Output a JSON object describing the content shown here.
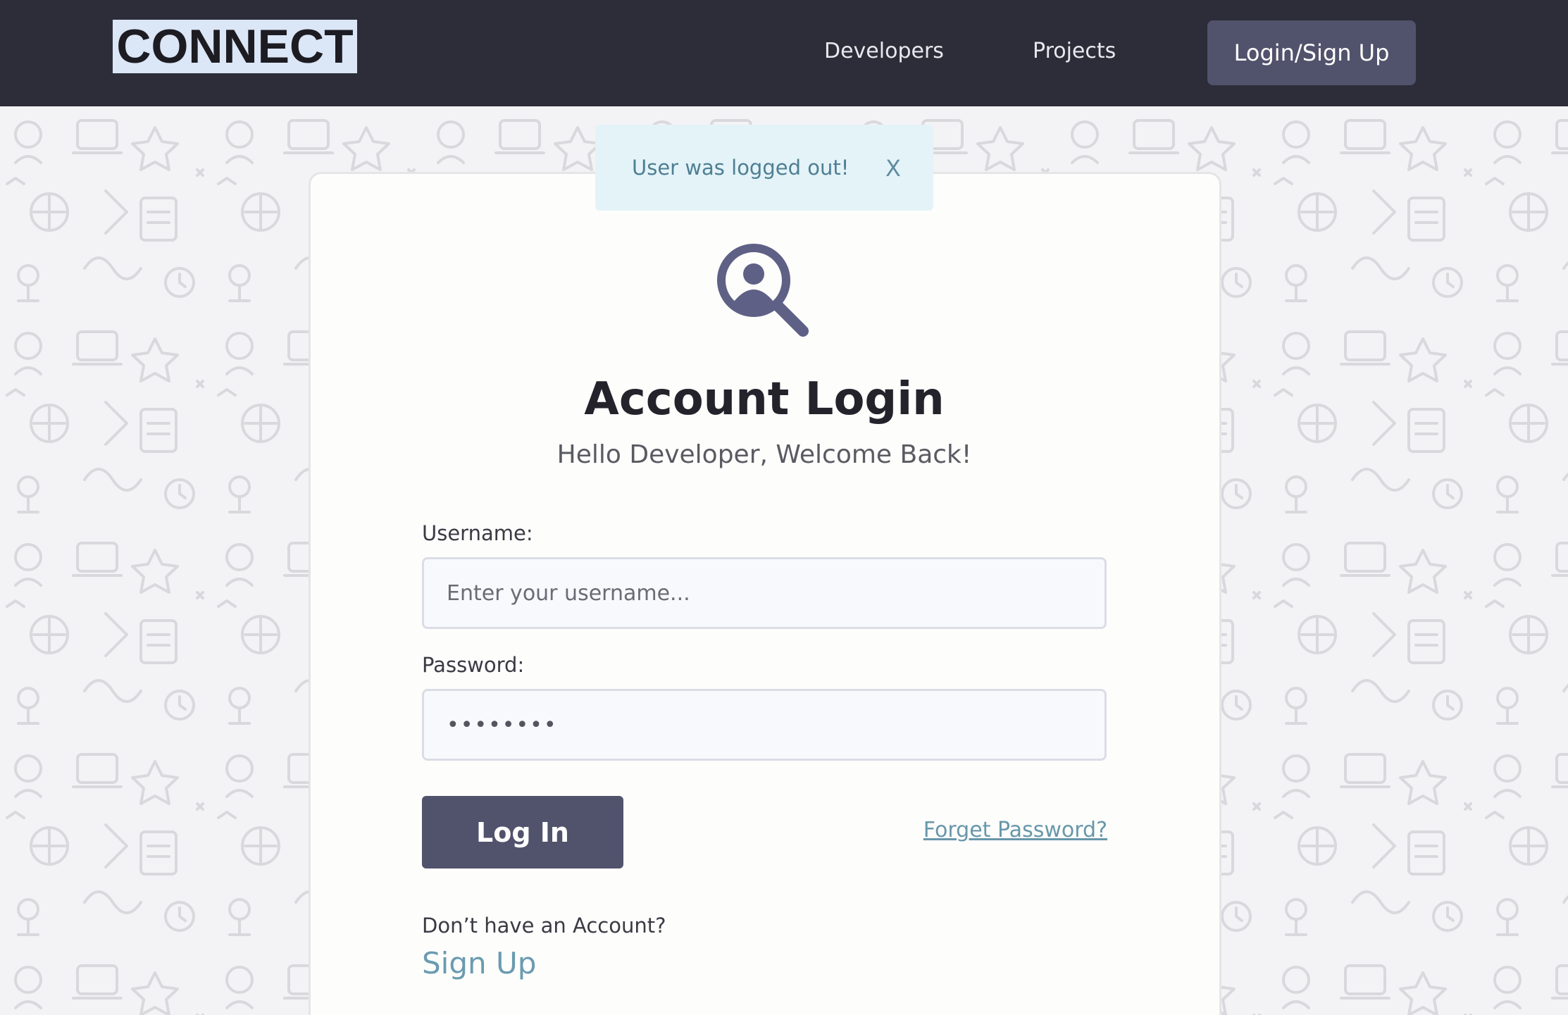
{
  "header": {
    "logo_text": "CONNECT",
    "nav": {
      "developers": "Developers",
      "projects": "Projects",
      "login_signup": "Login/Sign Up"
    }
  },
  "alert": {
    "message": "User was logged out!",
    "close_label": "X"
  },
  "login": {
    "icon": "user-search-icon",
    "title": "Account Login",
    "subtitle": "Hello Developer, Welcome Back!",
    "username_label": "Username:",
    "username_placeholder": "Enter your username...",
    "username_value": "",
    "password_label": "Password:",
    "password_value_masked": "••••••••",
    "submit_label": "Log In",
    "forgot_label": "Forget Password?",
    "no_account_text": "Don’t have an Account?",
    "signup_label": "Sign Up"
  },
  "colors": {
    "topbar": "#2d2d39",
    "accent_button": "#51526b",
    "link": "#6897aa",
    "alert_bg": "#e4f3f8"
  }
}
